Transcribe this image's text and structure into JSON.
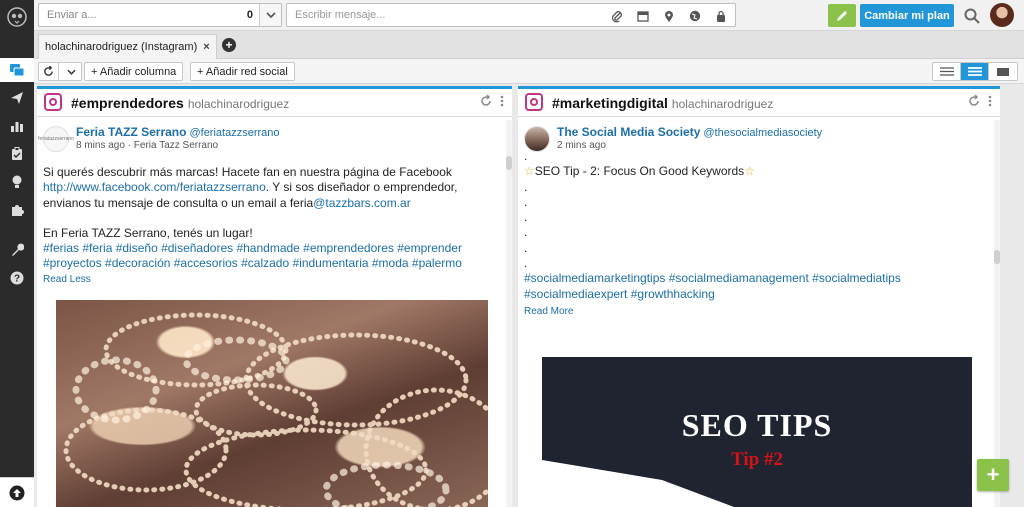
{
  "colors": {
    "accent": "#2196d9",
    "green": "#8bc34a",
    "sidebar": "#2b2b2b",
    "link": "#1b6ea8",
    "instagram": "#c13584"
  },
  "sidebar": {
    "logo": "owl-logo-icon",
    "items": [
      {
        "name": "streams-icon",
        "active": true
      },
      {
        "name": "publisher-icon"
      },
      {
        "name": "analytics-icon"
      },
      {
        "name": "assignments-icon"
      },
      {
        "name": "campaigns-icon"
      },
      {
        "name": "apps-icon"
      },
      {
        "name": "tools-icon"
      },
      {
        "name": "help-icon"
      }
    ],
    "bottom": "upload-icon"
  },
  "topbar": {
    "send_to_placeholder": "Enviar a...",
    "send_to_count": "0",
    "compose_placeholder": "Escribir mensaje...",
    "upgrade_label": "Cambiar mi plan"
  },
  "tabs": [
    {
      "label": "holachinarodriguez (Instagram)",
      "close": "×"
    }
  ],
  "toolbar": {
    "add_column": "+ Añadir columna",
    "add_network": "+ Añadir red social"
  },
  "streams": [
    {
      "title": "#emprendedores",
      "account": "holachinarodriguez",
      "post": {
        "author": "Feria TAZZ Serrano",
        "handle": "@feriatazzserrano",
        "avatar_text": "feriatazzserrano",
        "time": "8 mins ago",
        "source": "· Feria Tazz Serrano",
        "line1": "Si querés descubrir más marcas! Hacete fan en nuestra página de Facebook",
        "link": "http://www.facebook.com/feriatazzserrano",
        "line2a": ". Y si sos diseñador o emprendedor,",
        "line3a": "envianos tu mensaje de consulta o un email a feria",
        "email_link": "@tazzbars.com.ar",
        "line4": "En Feria TAZZ Serrano, tenés un lugar!",
        "tags1": "#ferias #feria #diseño #diseñadores #handmade #emprendedores #emprender",
        "tags2": "#proyectos #decoración #accesorios #calzado #indumentaria #moda #palermo",
        "read": "Read Less"
      }
    },
    {
      "title": "#marketingdigital",
      "account": "holachinarodriguez",
      "post": {
        "author": "The Social Media Society",
        "handle": "@thesocialmediasociety",
        "time": "2 mins ago",
        "dots": [
          ".",
          ".",
          ".",
          ".",
          ".",
          ".",
          "."
        ],
        "headline": "SEO Tip - 2: Focus On Good Keywords",
        "star": "☆",
        "tags1": "#socialmediamarketingtips #socialmediamanagement #socialmediatips",
        "tags2": "#socialmediaexpert #growthhacking",
        "read": "Read More",
        "image_title": "SEO TIPS",
        "image_sub": "Tip #2"
      }
    }
  ],
  "fab_label": "+"
}
